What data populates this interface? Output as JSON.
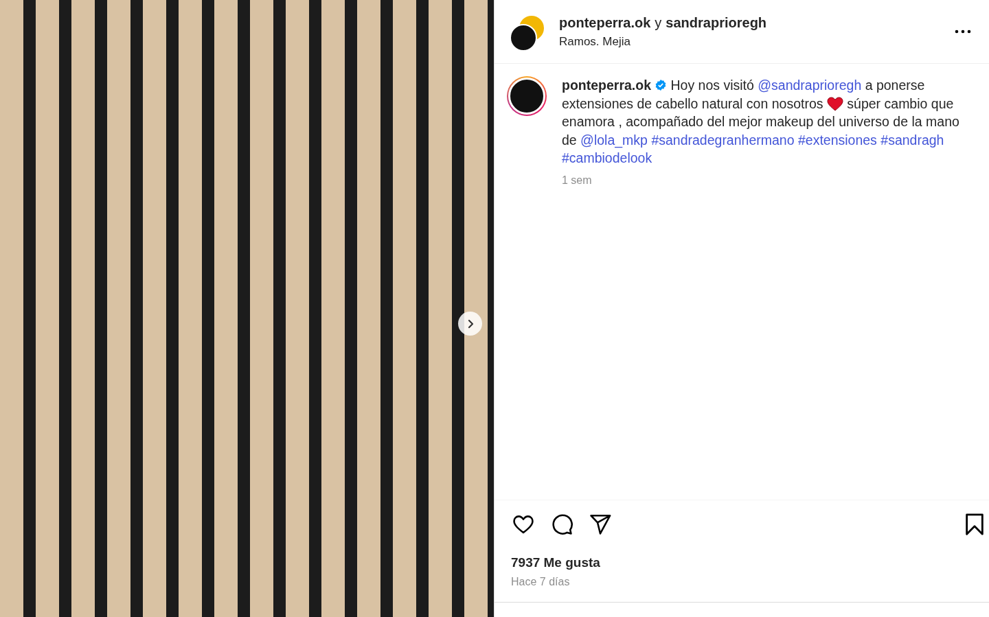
{
  "header": {
    "usernames": [
      "ponteperra.ok",
      "sandraprioregh"
    ],
    "joiner": "y",
    "location": "Ramos. Mejia"
  },
  "caption": {
    "username": "ponteperra.ok",
    "verified": true,
    "segments": [
      {
        "kind": "text",
        "text": "Hoy nos visitó "
      },
      {
        "kind": "link",
        "text": "@sandraprioregh"
      },
      {
        "kind": "text",
        "text": " a ponerse extensiones de cabello natural con nosotros "
      },
      {
        "kind": "heart"
      },
      {
        "kind": "text",
        "text": " súper cambio que enamora , acompañado del mejor makeup del universo de la mano de "
      },
      {
        "kind": "link",
        "text": "@lola_mkp"
      },
      {
        "kind": "space"
      },
      {
        "kind": "link",
        "text": "#sandradegranhermano"
      },
      {
        "kind": "space"
      },
      {
        "kind": "link",
        "text": "#extensiones"
      },
      {
        "kind": "space"
      },
      {
        "kind": "link",
        "text": "#sandragh"
      },
      {
        "kind": "space"
      },
      {
        "kind": "link",
        "text": "#cambiodelook"
      }
    ],
    "age": "1 sem"
  },
  "likes": "7937 Me gusta",
  "date": "Hace 7 días"
}
